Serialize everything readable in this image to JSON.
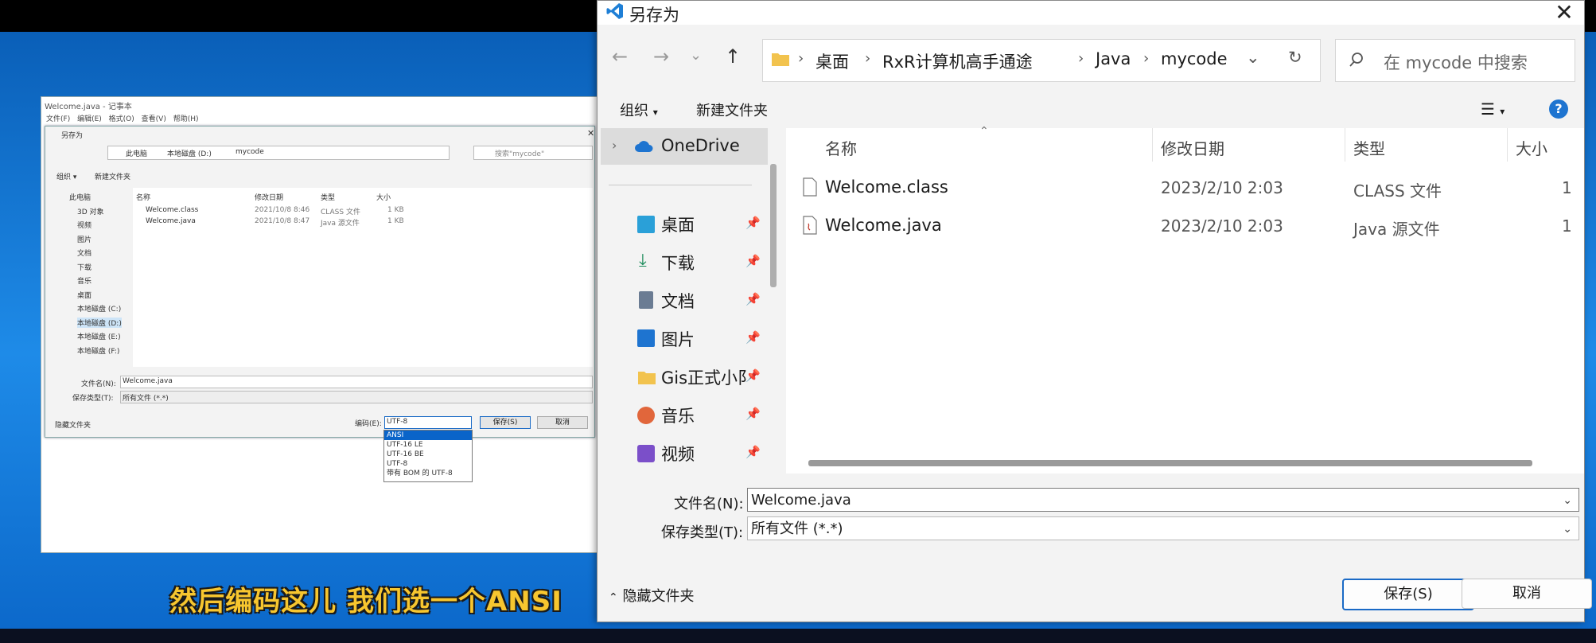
{
  "subtitle": "然后编码这儿 我们选一个ANSI",
  "notepad": {
    "title": "Welcome.java - 记事本",
    "menu": [
      "文件(F)",
      "编辑(E)",
      "格式(O)",
      "查看(V)",
      "帮助(H)"
    ],
    "dialog": {
      "title": "另存为",
      "path": [
        "此电脑",
        "本地磁盘 (D:)",
        "mycode"
      ],
      "search_placeholder": "搜索\"mycode\"",
      "toolbar": {
        "organize": "组织 ▾",
        "new_folder": "新建文件夹"
      },
      "tree": [
        "此电脑",
        "3D 对象",
        "视频",
        "图片",
        "文档",
        "下载",
        "音乐",
        "桌面",
        "本地磁盘 (C:)",
        "本地磁盘 (D:)",
        "本地磁盘 (E:)",
        "本地磁盘 (F:)"
      ],
      "columns": [
        "名称",
        "修改日期",
        "类型",
        "大小"
      ],
      "files": [
        {
          "name": "Welcome.class",
          "date": "2021/10/8 8:46",
          "type": "CLASS 文件",
          "size": "1 KB"
        },
        {
          "name": "Welcome.java",
          "date": "2021/10/8 8:47",
          "type": "Java 源文件",
          "size": "1 KB"
        }
      ],
      "filename_label": "文件名(N):",
      "filename_value": "Welcome.java",
      "filetype_label": "保存类型(T):",
      "filetype_value": "所有文件 (*.*)",
      "hide_folders": "隐藏文件夹",
      "encoding_label": "编码(E):",
      "encoding_value": "UTF-8",
      "save": "保存(S)",
      "cancel": "取消",
      "encoding_options": [
        "ANSI",
        "UTF-16 LE",
        "UTF-16 BE",
        "UTF-8",
        "带有 BOM 的 UTF-8"
      ]
    }
  },
  "dialog": {
    "title": "另存为",
    "breadcrumbs": [
      "桌面",
      "RxR计算机高手通途",
      "Java",
      "mycode"
    ],
    "search_placeholder": "在 mycode 中搜索",
    "toolbar": {
      "organize": "组织",
      "new_folder": "新建文件夹"
    },
    "help": "?",
    "nav": [
      {
        "label": "OneDrive",
        "icon": "cloud-icon",
        "color": "#1e74d0"
      },
      {
        "label": "桌面",
        "icon": "desktop-icon",
        "color": "#2aa0d8"
      },
      {
        "label": "下载",
        "icon": "download-icon",
        "color": "#1a8a5a"
      },
      {
        "label": "文档",
        "icon": "document-icon",
        "color": "#6b7c93"
      },
      {
        "label": "图片",
        "icon": "picture-icon",
        "color": "#1e74d0"
      },
      {
        "label": "Gis正式小阝",
        "icon": "folder-icon",
        "color": "#f2c34e"
      },
      {
        "label": "音乐",
        "icon": "music-icon",
        "color": "#e1663b"
      },
      {
        "label": "视频",
        "icon": "video-icon",
        "color": "#7b4fc9"
      }
    ],
    "columns": {
      "name": "名称",
      "date": "修改日期",
      "type": "类型",
      "size": "大小"
    },
    "files": [
      {
        "name": "Welcome.class",
        "date": "2023/2/10 2:03",
        "type": "CLASS 文件",
        "size": "1"
      },
      {
        "name": "Welcome.java",
        "date": "2023/2/10 2:03",
        "type": "Java 源文件",
        "size": "1"
      }
    ],
    "filename_label": "文件名(N):",
    "filename_value": "Welcome.java",
    "filetype_label": "保存类型(T):",
    "filetype_value": "所有文件 (*.*)",
    "hide_folders": "隐藏文件夹",
    "save": "保存(S)",
    "cancel": "取消"
  }
}
